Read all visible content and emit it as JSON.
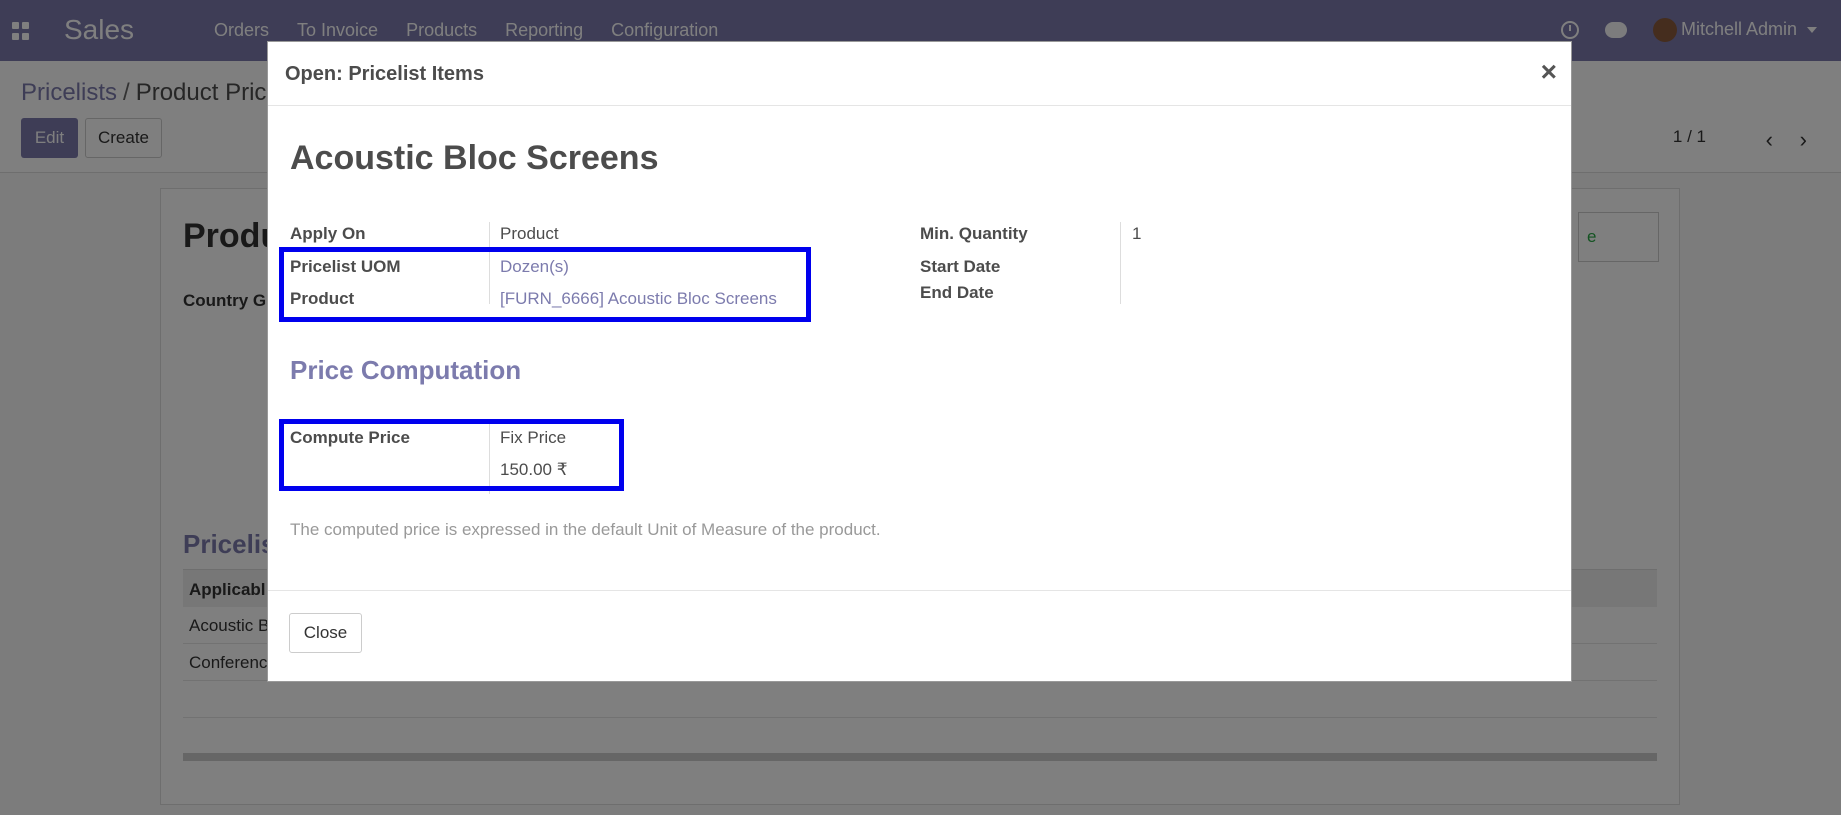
{
  "app": {
    "name": "Sales",
    "menu": [
      "Orders",
      "To Invoice",
      "Products",
      "Reporting",
      "Configuration"
    ],
    "user": "Mitchell Admin"
  },
  "breadcrumb": {
    "parent": "Pricelists",
    "separator": "/",
    "current": "Product Pric"
  },
  "actions": {
    "edit": "Edit",
    "create": "Create"
  },
  "pager": {
    "text": "1 / 1"
  },
  "background_sheet": {
    "title": "Produ",
    "country_label": "Country G",
    "section": "Pricelis",
    "table_header": "Applicabl",
    "rows": [
      "Acoustic B",
      "Conferenc"
    ],
    "partial_button_text": "e"
  },
  "modal": {
    "title": "Open: Pricelist Items",
    "close_symbol": "×",
    "record_name": "Acoustic Bloc Screens",
    "fields_left": [
      {
        "label": "Apply On",
        "value": "Product"
      },
      {
        "label": "Pricelist UOM",
        "value": "Dozen(s)"
      },
      {
        "label": "Product",
        "value": "[FURN_6666] Acoustic Bloc Screens"
      }
    ],
    "fields_right": [
      {
        "label": "Min. Quantity",
        "value": "1"
      },
      {
        "label": "Start Date",
        "value": ""
      },
      {
        "label": "End Date",
        "value": ""
      }
    ],
    "section_title": "Price Computation",
    "compute_price": {
      "label": "Compute Price",
      "value": "Fix Price",
      "amount": "150.00 ₹"
    },
    "help_text": "The computed price is expressed in the default Unit of Measure of the product.",
    "close_button": "Close"
  },
  "colors": {
    "brand": "#7c7bad",
    "highlight": "#0000ee"
  }
}
